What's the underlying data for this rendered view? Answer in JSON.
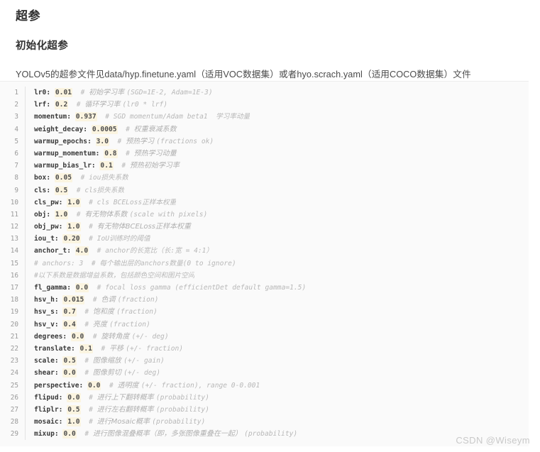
{
  "document": {
    "heading_main": "超参",
    "heading_sub": "初始化超参",
    "paragraph": "YOLOv5的超参文件见data/hyp.finetune.yaml（适用VOC数据集）或者hyo.scrach.yaml（适用COCO数据集）文件",
    "watermark": "CSDN @Wiseym"
  },
  "colors": {
    "code_background": "#fafafa",
    "value_highlight": "#fbf4e0",
    "comment": "#b8b8b8",
    "keyword": "#3a3a3a",
    "gutter": "#9b9b9b"
  },
  "code": {
    "language": "yaml",
    "lines": [
      {
        "n": "1",
        "key": "lr0:",
        "value": "0.01",
        "comment": "#",
        "cn": "初始学习率",
        "en": "(SGD=1E-2, Adam=1E-3)"
      },
      {
        "n": "2",
        "key": "lrf:",
        "value": "0.2",
        "comment": "#",
        "cn": "循环学习率",
        "en": "(lr0 * lrf)"
      },
      {
        "n": "3",
        "key": "momentum:",
        "value": "0.937",
        "comment": "#",
        "cn": "",
        "en": "SGD momentum/Adam beta1  学习率动量"
      },
      {
        "n": "4",
        "key": "weight_decay:",
        "value": "0.0005",
        "comment": "#",
        "cn": "权重衰减系数",
        "en": ""
      },
      {
        "n": "5",
        "key": "warmup_epochs:",
        "value": "3.0",
        "comment": "#",
        "cn": "预热学习",
        "en": "(fractions ok)"
      },
      {
        "n": "6",
        "key": "warmup_momentum:",
        "value": "0.8",
        "comment": "#",
        "cn": "预热学习动量",
        "en": ""
      },
      {
        "n": "7",
        "key": "warmup_bias_lr:",
        "value": "0.1",
        "comment": "#",
        "cn": "预热初始学习率",
        "en": ""
      },
      {
        "n": "8",
        "key": "box:",
        "value": "0.05",
        "comment": "#",
        "cn": "",
        "en": "iou损失系数"
      },
      {
        "n": "9",
        "key": "cls:",
        "value": "0.5",
        "comment": "#",
        "cn": "",
        "en": "cls损失系数"
      },
      {
        "n": "10",
        "key": "cls_pw:",
        "value": "1.0",
        "comment": "#",
        "cn": "",
        "en": "cls BCELoss正样本权重"
      },
      {
        "n": "11",
        "key": "obj:",
        "value": "1.0",
        "comment": "#",
        "cn": "有无物体系数",
        "en": "(scale with pixels)"
      },
      {
        "n": "12",
        "key": "obj_pw:",
        "value": "1.0",
        "comment": "#",
        "cn": "有无物体BCELoss正样本权重",
        "en": ""
      },
      {
        "n": "13",
        "key": "iou_t:",
        "value": "0.20",
        "comment": "#",
        "cn": "",
        "en": "IoU训练时的阈值"
      },
      {
        "n": "14",
        "key": "anchor_t:",
        "value": "4.0",
        "comment": "#",
        "cn": "",
        "en": "anchor的长宽比（长:宽 = 4:1）"
      },
      {
        "n": "15",
        "key": "",
        "value": "",
        "comment": "",
        "cn": "",
        "en": "",
        "full": "# anchors: 3  # 每个输出层的anchors数量(0 to ignore)"
      },
      {
        "n": "16",
        "key": "",
        "value": "",
        "comment": "",
        "cn": "",
        "en": "",
        "full": "#以下系数是数据增益系数，包括颜色空间和图片空间"
      },
      {
        "n": "17",
        "key": "fl_gamma:",
        "value": "0.0",
        "comment": "#",
        "cn": "",
        "en": "focal loss gamma (efficientDet default gamma=1.5)"
      },
      {
        "n": "18",
        "key": "hsv_h:",
        "value": "0.015",
        "comment": "#",
        "cn": "色调",
        "en": "(fraction)"
      },
      {
        "n": "19",
        "key": "hsv_s:",
        "value": "0.7",
        "comment": "#",
        "cn": "饱和度",
        "en": "(fraction)"
      },
      {
        "n": "20",
        "key": "hsv_v:",
        "value": "0.4",
        "comment": "#",
        "cn": "亮度",
        "en": "(fraction)"
      },
      {
        "n": "21",
        "key": "degrees:",
        "value": "0.0",
        "comment": "#",
        "cn": "旋转角度",
        "en": "(+/- deg)"
      },
      {
        "n": "22",
        "key": "translate:",
        "value": "0.1",
        "comment": "#",
        "cn": "平移",
        "en": "(+/- fraction)"
      },
      {
        "n": "23",
        "key": "scale:",
        "value": "0.5",
        "comment": "#",
        "cn": "图像缩放",
        "en": "(+/- gain)"
      },
      {
        "n": "24",
        "key": "shear:",
        "value": "0.0",
        "comment": "#",
        "cn": "图像剪切",
        "en": "(+/- deg)"
      },
      {
        "n": "25",
        "key": "perspective:",
        "value": "0.0",
        "comment": "#",
        "cn": "透明度",
        "en": "(+/- fraction), range 0-0.001"
      },
      {
        "n": "26",
        "key": "flipud:",
        "value": "0.0",
        "comment": "#",
        "cn": "进行上下翻转概率",
        "en": "(probability)"
      },
      {
        "n": "27",
        "key": "fliplr:",
        "value": "0.5",
        "comment": "#",
        "cn": "进行左右翻转概率",
        "en": "(probability)"
      },
      {
        "n": "28",
        "key": "mosaic:",
        "value": "1.0",
        "comment": "#",
        "cn": "进行Mosaic概率",
        "en": "(probability)"
      },
      {
        "n": "29",
        "key": "mixup:",
        "value": "0.0",
        "comment": "#",
        "cn": "进行图像混叠概率（即，多张图像重叠在一起）",
        "en": "(probability)"
      }
    ]
  }
}
